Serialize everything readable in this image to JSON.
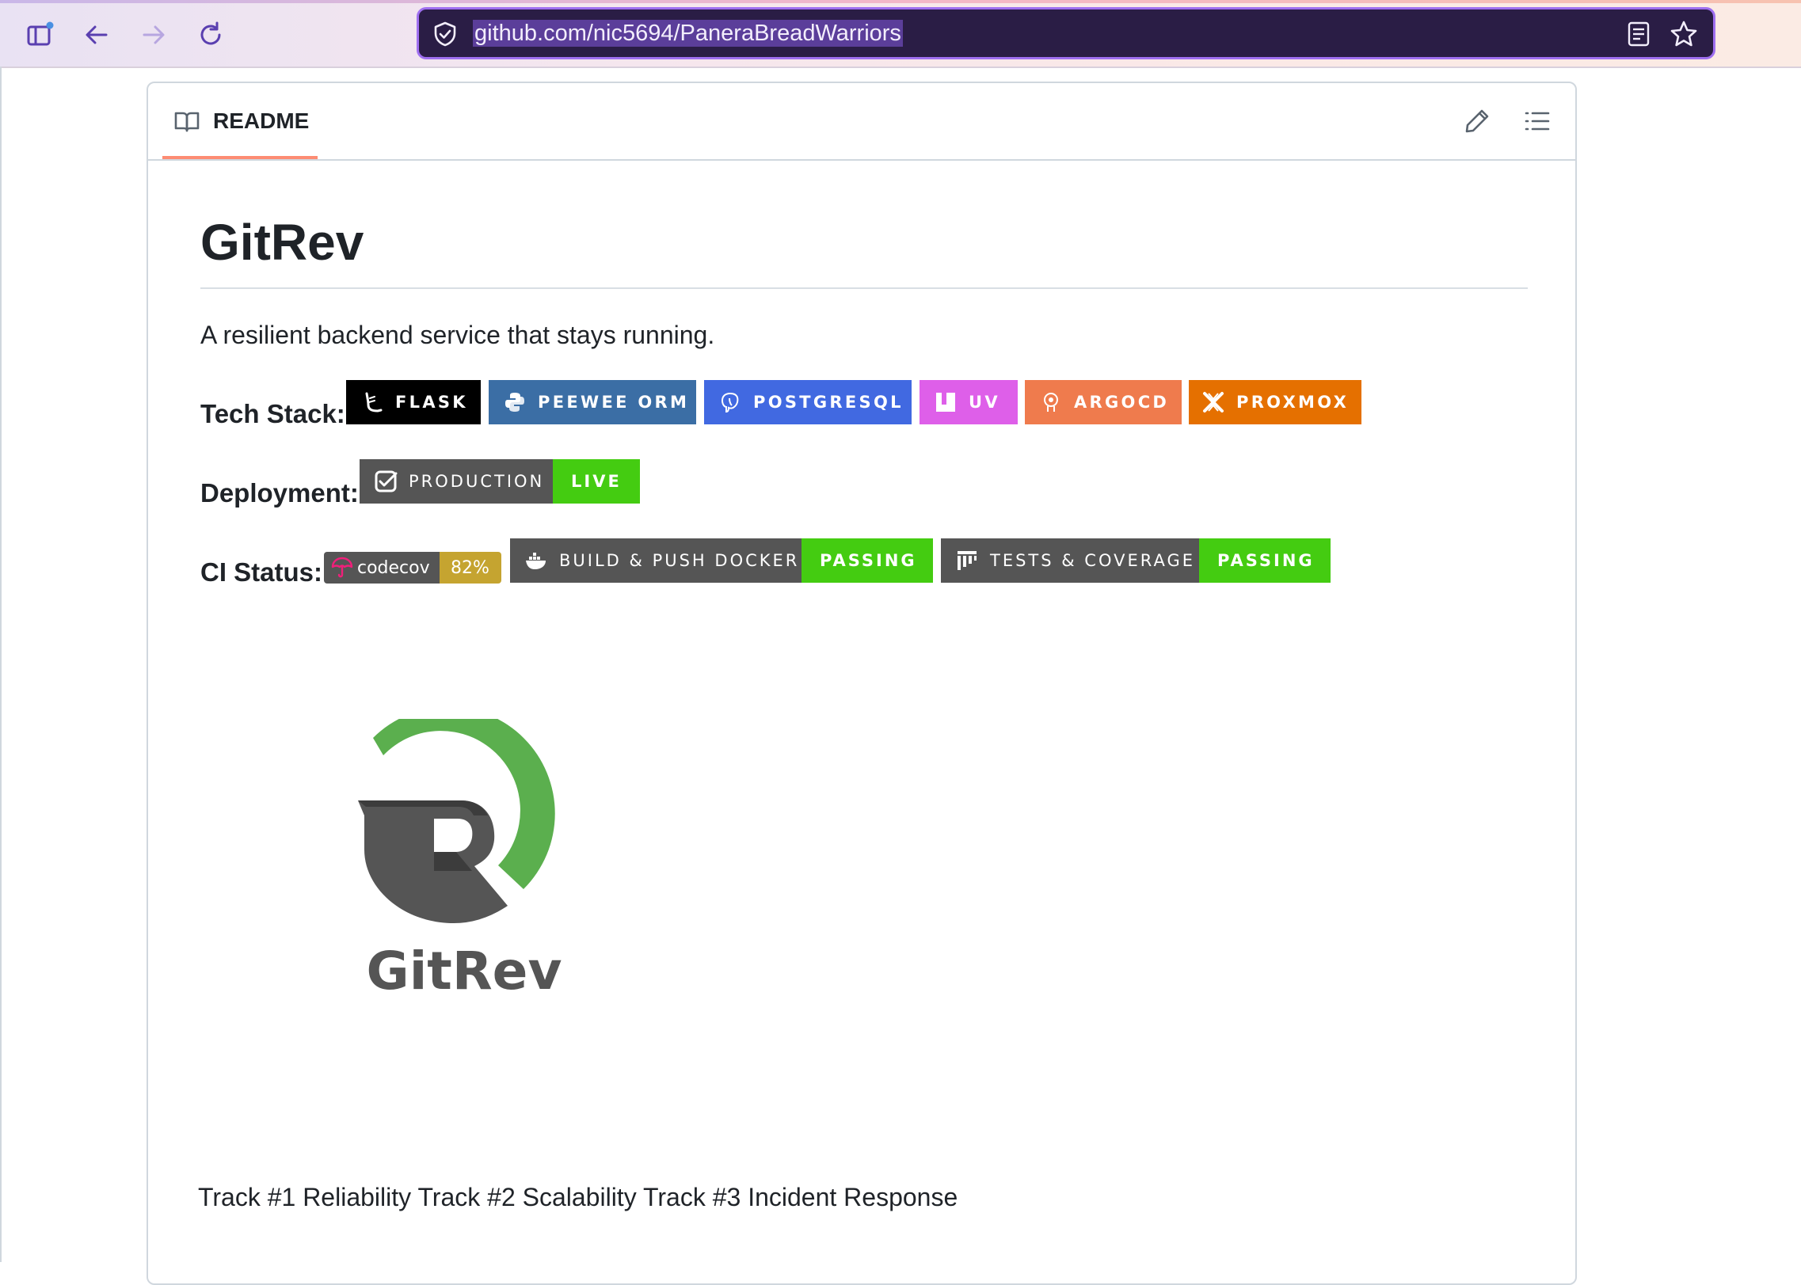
{
  "browser": {
    "url": "github.com/nic5694/PaneraBreadWarriors",
    "url_highlight_color": "#5b3e9a",
    "accent_color": "#9f6ff0",
    "icons": [
      "sidebar-icon",
      "back-icon",
      "forward-icon",
      "reload-icon",
      "shield-icon",
      "reader-view-icon",
      "star-icon"
    ]
  },
  "readme": {
    "tab_label": "README",
    "tab_underline_color": "#fd8c73",
    "icons": [
      "book-icon",
      "pencil-icon",
      "list-icon"
    ],
    "title": "GitRev",
    "description": "A resilient backend service that stays running.",
    "tech_stack": {
      "label": "Tech Stack:",
      "badges": [
        {
          "text": "FLASK",
          "color": "#000000",
          "icon": "flask-icon"
        },
        {
          "text": "PEEWEE ORM",
          "color": "#3b6ea5",
          "icon": "python-icon"
        },
        {
          "text": "POSTGRESQL",
          "color": "#4169e1",
          "icon": "postgresql-icon"
        },
        {
          "text": "UV",
          "color": "#de5fe9",
          "icon": "uv-icon"
        },
        {
          "text": "ARGOCD",
          "color": "#ef7b4d",
          "icon": "argocd-icon"
        },
        {
          "text": "PROXMOX",
          "color": "#e57000",
          "icon": "proxmox-icon"
        }
      ]
    },
    "deployment": {
      "label": "Deployment:",
      "badge": {
        "label": "PRODUCTION",
        "message": "LIVE",
        "label_color": "#555555",
        "message_color": "#4c1",
        "icon": "checkbox-icon"
      }
    },
    "ci_status": {
      "label": "CI Status:",
      "codecov": {
        "label": "codecov",
        "value": "82%",
        "value_color": "#c5a430",
        "icon": "codecov-umbrella-icon"
      },
      "badges": [
        {
          "label": "BUILD & PUSH DOCKER",
          "message": "PASSING",
          "icon": "docker-icon"
        },
        {
          "label": "TESTS & COVERAGE",
          "message": "PASSING",
          "icon": "pytest-icon"
        }
      ]
    },
    "logo": {
      "text": "GitRev",
      "green": "#5baf4e",
      "gray": "#555555"
    },
    "tracks": "Track #1 Reliability Track #2 Scalability Track #3 Incident Response"
  }
}
